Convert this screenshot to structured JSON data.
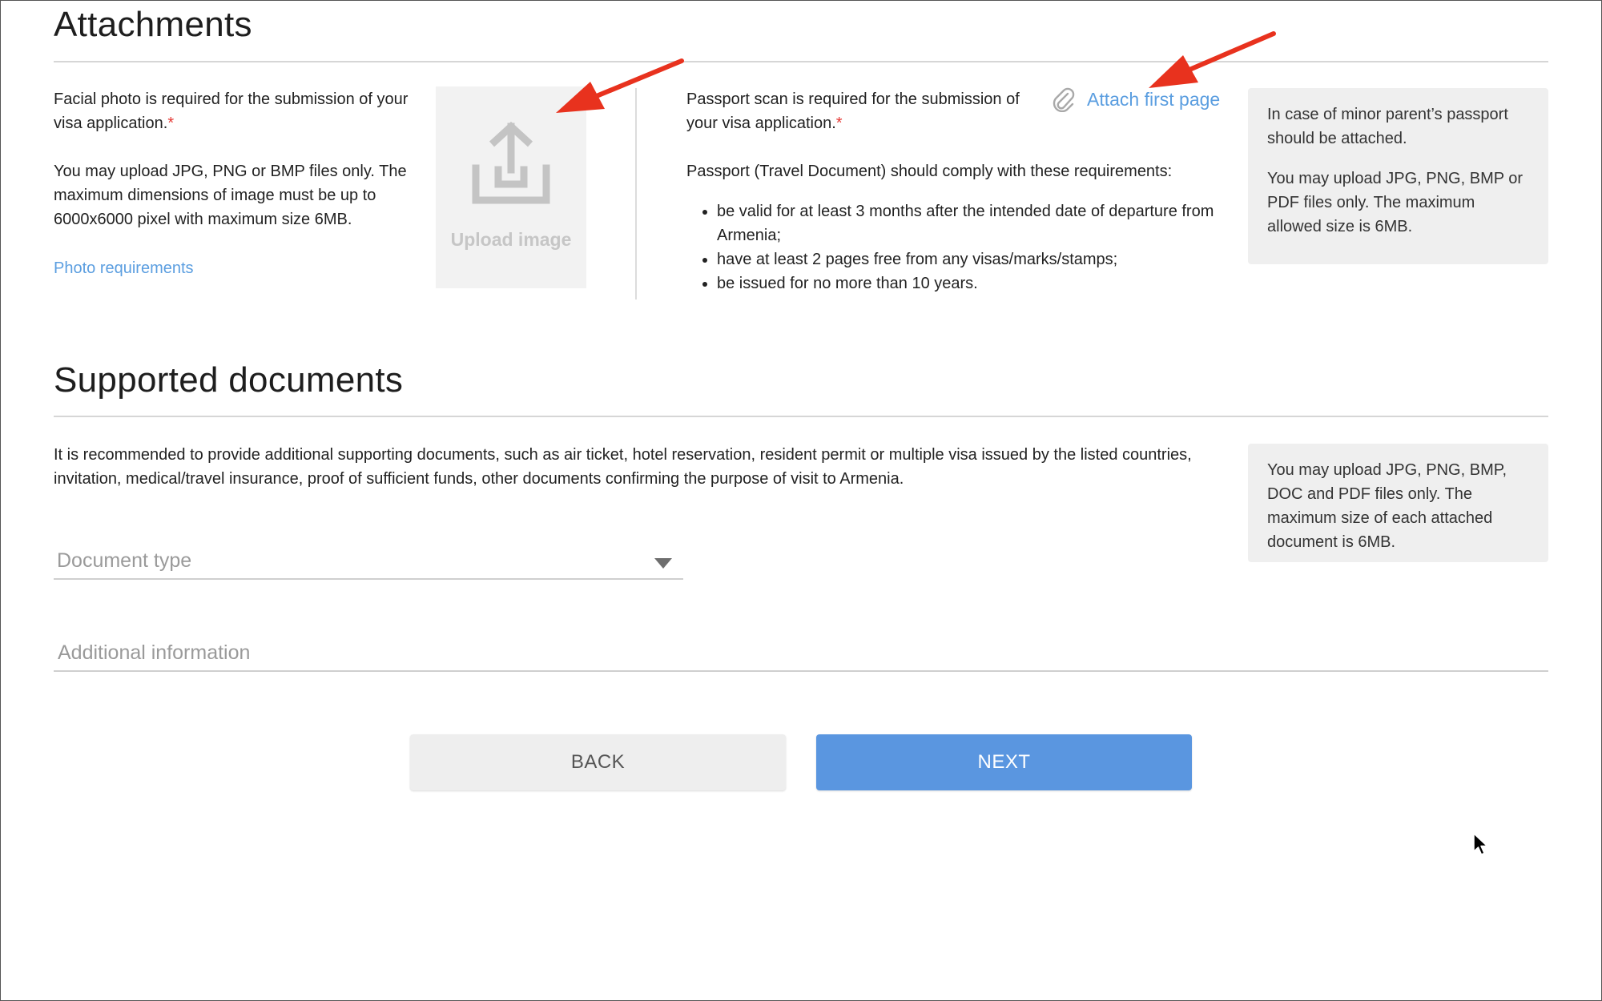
{
  "attachments": {
    "title": "Attachments",
    "photo": {
      "required_text": "Facial photo is required for the submission of your visa application.",
      "required_marker": "*",
      "formats_text": "You may upload JPG, PNG or BMP files only. The maximum dimensions of image must be up to 6000x6000 pixel with maximum size 6MB.",
      "requirements_link": "Photo requirements",
      "upload_label": "Upload image",
      "upload_icon": "upload-icon"
    },
    "passport": {
      "required_text": "Passport scan is required for the submission of your visa application.",
      "required_marker": "*",
      "attach_link": "Attach first page",
      "attach_icon": "paperclip-icon",
      "comply_text": "Passport (Travel Document) should comply with these requirements:",
      "requirements": [
        "be valid for at least 3 months after the intended date of departure from Armenia;",
        "have at least 2 pages free from any visas/marks/stamps;",
        "be issued for no more than 10 years."
      ]
    },
    "info": {
      "p1": "In case of minor parent’s passport should be attached.",
      "p2": "You may upload JPG, PNG, BMP or PDF files only. The maximum allowed size is 6MB."
    }
  },
  "supported": {
    "title": "Supported documents",
    "description": "It is recommended to provide additional supporting documents, such as air ticket, hotel reservation, resident permit or multiple visa issued by the listed countries, invitation, medical/travel insurance, proof of sufficient funds, other documents confirming the purpose of visit to Armenia.",
    "document_type_placeholder": "Document type",
    "additional_info_placeholder": "Additional information",
    "info": "You may upload JPG, PNG, BMP, DOC and PDF files only. The maximum size of each attached document is 6MB."
  },
  "buttons": {
    "back": "BACK",
    "next": "NEXT"
  },
  "colors": {
    "accent": "#5a96e0",
    "link": "#5b9ee0",
    "required": "#e53935",
    "annotation_arrow": "#e8321e"
  }
}
